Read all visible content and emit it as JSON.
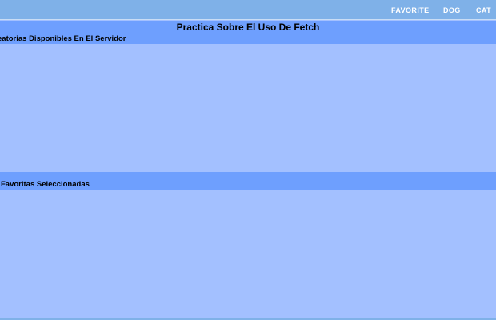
{
  "nav": {
    "favorite": "FAVORITE",
    "dog": "DOG",
    "cat": "CAT"
  },
  "page": {
    "title": "Practica Sobre El Uso De Fetch",
    "available_heading": "eatorias Disponibles En El Servidor",
    "favorites_heading": "Favoritas Seleccionadas"
  },
  "colors": {
    "nav_bar": "#7fb1e8",
    "heading_band": "#6e9ffe",
    "panel": "#a3c0ff",
    "nav_text": "#ffffff"
  }
}
